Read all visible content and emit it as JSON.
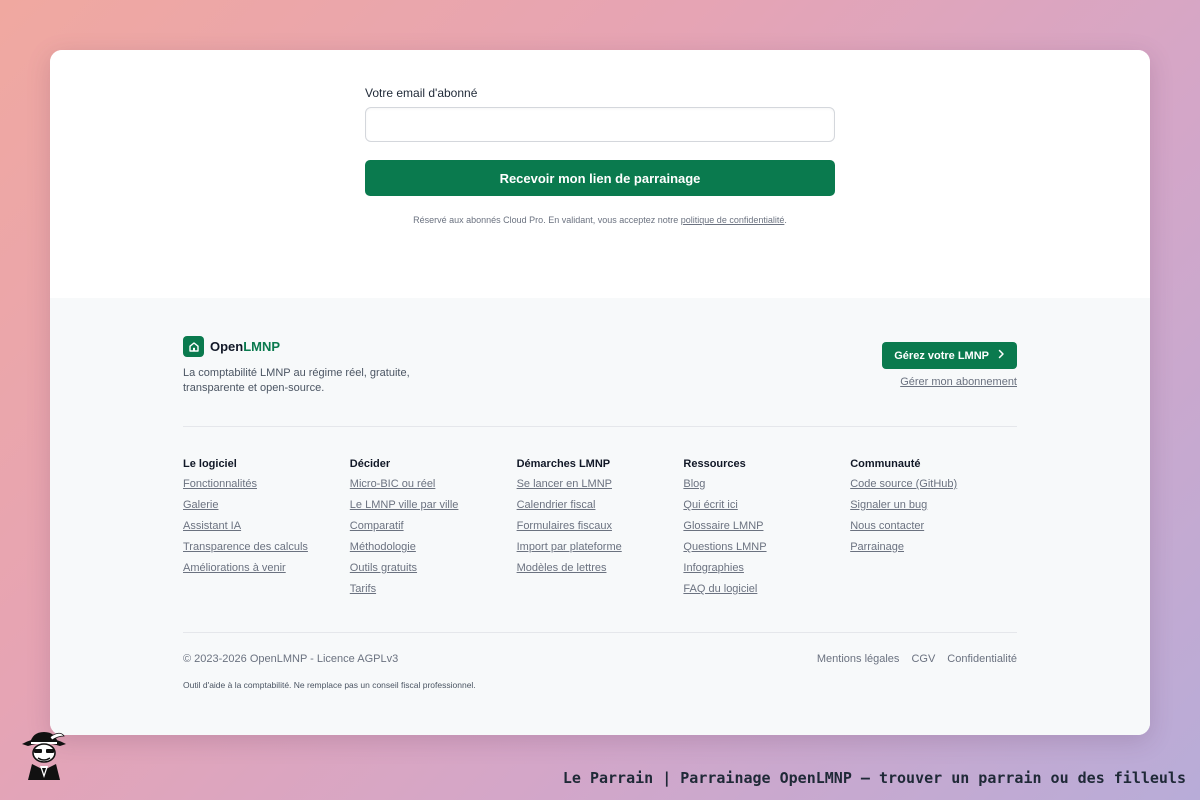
{
  "form": {
    "email_label": "Votre email d'abonné",
    "email_value": "",
    "email_placeholder": "",
    "submit_label": "Recevoir mon lien de parrainage",
    "note_prefix": "Réservé aux abonnés Cloud Pro. En validant, vous acceptez notre ",
    "note_link": "politique de confidentialité",
    "note_suffix": "."
  },
  "footer": {
    "brand_prefix": "Open",
    "brand_accent": "LMNP",
    "tagline": "La comptabilité LMNP au régime réel, gratuite, transparente et open-source.",
    "cta_label": "Gérez votre LMNP",
    "manage_link": "Gérer mon abonnement",
    "columns": [
      {
        "title": "Le logiciel",
        "links": [
          "Fonctionnalités",
          "Galerie",
          "Assistant IA",
          "Transparence des calculs",
          "Améliorations à venir"
        ]
      },
      {
        "title": "Décider",
        "links": [
          "Micro-BIC ou réel",
          "Le LMNP ville par ville",
          "Comparatif",
          "Méthodologie",
          "Outils gratuits",
          "Tarifs"
        ]
      },
      {
        "title": "Démarches LMNP",
        "links": [
          "Se lancer en LMNP",
          "Calendrier fiscal",
          "Formulaires fiscaux",
          "Import par plateforme",
          "Modèles de lettres"
        ]
      },
      {
        "title": "Ressources",
        "links": [
          "Blog",
          "Qui écrit ici",
          "Glossaire LMNP",
          "Questions LMNP",
          "Infographies",
          "FAQ du logiciel"
        ]
      },
      {
        "title": "Communauté",
        "links": [
          "Code source (GitHub)",
          "Signaler un bug",
          "Nous contacter",
          "Parrainage"
        ]
      }
    ],
    "copyright": "© 2023-2026 OpenLMNP - Licence AGPLv3",
    "legal_links": [
      "Mentions légales",
      "CGV",
      "Confidentialité"
    ],
    "disclaimer": "Outil d'aide à la comptabilité. Ne remplace pas un conseil fiscal professionnel."
  },
  "caption": "Le Parrain | Parrainage OpenLMNP — trouver un parrain ou des filleuls",
  "colors": {
    "brand": "#0a7a4e",
    "footer_bg": "#f7f9fa"
  },
  "icons": {
    "logo": "house-icon",
    "cta": "chevron-right-icon",
    "avatar": "godfather-avatar"
  }
}
